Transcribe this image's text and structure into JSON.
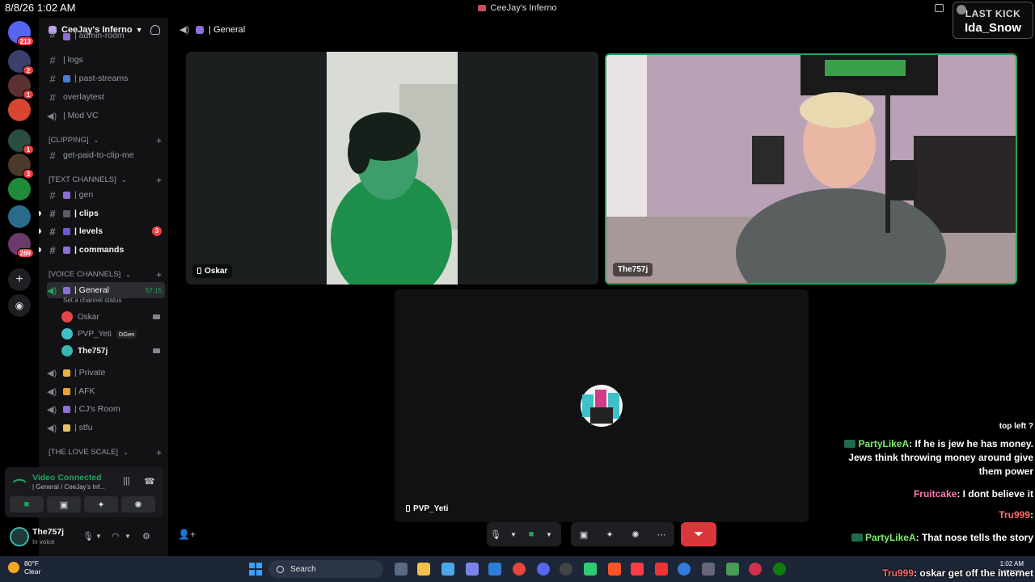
{
  "topbar": {
    "clock": "8/8/26 1:02 AM",
    "window_title": "CeeJay's Inferno"
  },
  "overlay": {
    "last_kick_label": "LAST KICK",
    "last_kick_user": "Ida_Snow"
  },
  "rail": {
    "home_badge": "213",
    "servers": [
      {
        "badge": "2",
        "color": "#3b3f6b"
      },
      {
        "badge": "1",
        "color": "#5a3030"
      },
      {
        "badge": "",
        "color": "#d9462f"
      },
      {
        "badge": "1",
        "color": "#2b4d3f"
      },
      {
        "badge": "3",
        "color": "#4a3a2a"
      },
      {
        "badge": "",
        "color": "#1f8a3a"
      },
      {
        "badge": "",
        "color": "#2a6a8a"
      },
      {
        "badge": "289",
        "color": "#6a3a6a"
      }
    ]
  },
  "sidebar": {
    "guild_name": "CeeJay's Inferno",
    "channels_top": [
      {
        "name": "| admin-room",
        "type": "text"
      },
      {
        "name": "| logs",
        "type": "text"
      },
      {
        "name": "| past-streams",
        "type": "text"
      },
      {
        "name": "overlaytest",
        "type": "text"
      },
      {
        "name": "| Mod VC",
        "type": "voice"
      }
    ],
    "cat_clipping": "[CLIPPING]",
    "clip_channel": "get-paid-to-clip-me",
    "cat_text": "[TEXT CHANNELS]",
    "text_channels": [
      {
        "name": "| gen",
        "bold": false,
        "count": ""
      },
      {
        "name": "| clips",
        "bold": true,
        "count": ""
      },
      {
        "name": "| levels",
        "bold": true,
        "count": "3"
      },
      {
        "name": "| commands",
        "bold": true,
        "count": ""
      }
    ],
    "cat_voice": "[VOICE CHANNELS]",
    "voice_general": "| General",
    "voice_timer": "57:15",
    "channel_status": "Set a channel status",
    "voice_users": [
      {
        "name": "Oskar",
        "tag": "",
        "color": "#e0454a"
      },
      {
        "name": "PVP_Yeti",
        "tag": "DGen",
        "color": "#3fc0c8"
      },
      {
        "name": "The757j",
        "tag": "",
        "color": "#3ab5b0"
      }
    ],
    "voice_others": [
      "| Private",
      "| AFK",
      "| CJ's Room",
      "| stfu"
    ],
    "cat_love": "[THE LOVE SCALE]"
  },
  "voice_panel": {
    "status": "Video Connected",
    "sub": "| General / CeeJay's Inf..."
  },
  "user_panel": {
    "name": "The757j",
    "status": "In voice"
  },
  "main": {
    "channel_title": "| General",
    "tiles": [
      {
        "name": "Oskar"
      },
      {
        "name": "The757j"
      },
      {
        "name": "PVP_Yeti"
      }
    ]
  },
  "chat": [
    {
      "user": "",
      "text": "top left ?",
      "color": "#ffffff"
    },
    {
      "user": "PartyLikeA",
      "text": ": If he is jew he has money. Jews think throwing money around give them power",
      "color": "#7cf06a"
    },
    {
      "user": "Fruitcake",
      "text": ": I dont believe it",
      "color": "#ff7bb0"
    },
    {
      "user": "Tru999",
      "text": ":",
      "color": "#ff6b6b"
    },
    {
      "user": "PartyLikeA",
      "text": ": That nose tells the story",
      "color": "#7cf06a"
    },
    {
      "user": "Tru999",
      "text": ": oskar get off the internet",
      "color": "#ff6b6b"
    }
  ],
  "taskbar": {
    "temp": "80°F",
    "weather": "Clear",
    "search": "Search",
    "time": "1:02 AM",
    "date": "8/8/2026"
  }
}
